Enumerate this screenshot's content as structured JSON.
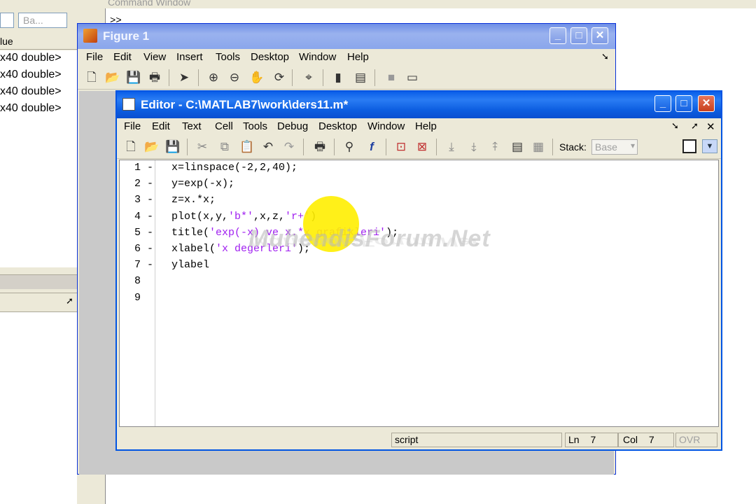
{
  "workspace": {
    "select_a": "",
    "select_b": "Ba...",
    "header": "lue",
    "rows": [
      "x40 double>",
      "x40 double>",
      "x40 double>",
      "x40 double>"
    ],
    "chevrons": "»"
  },
  "command_window": {
    "title": "Command Window",
    "prompt": ">>"
  },
  "figure": {
    "title": "Figure 1",
    "menu": [
      "File",
      "Edit",
      "View",
      "Insert",
      "Tools",
      "Desktop",
      "Window",
      "Help"
    ]
  },
  "editor": {
    "title": "Editor - C:\\MATLAB7\\work\\ders11.m*",
    "menu": [
      "File",
      "Edit",
      "Text",
      "Cell",
      "Tools",
      "Debug",
      "Desktop",
      "Window",
      "Help"
    ],
    "stack_label": "Stack:",
    "stack_value": "Base",
    "lines": [
      {
        "num": "1",
        "dash": "-",
        "parts": [
          {
            "t": "x=linspace(-2,2,40);",
            "s": false
          }
        ]
      },
      {
        "num": "2",
        "dash": "-",
        "parts": [
          {
            "t": "y=exp(-x);",
            "s": false
          }
        ]
      },
      {
        "num": "3",
        "dash": "-",
        "parts": [
          {
            "t": "z=x.*x;",
            "s": false
          }
        ]
      },
      {
        "num": "4",
        "dash": "-",
        "parts": [
          {
            "t": "plot(x,y,",
            "s": false
          },
          {
            "t": "'b*'",
            "s": true
          },
          {
            "t": ",x,z,",
            "s": false
          },
          {
            "t": "'r+'",
            "s": true
          },
          {
            "t": ")",
            "s": false
          }
        ]
      },
      {
        "num": "5",
        "dash": "-",
        "parts": [
          {
            "t": "title(",
            "s": false
          },
          {
            "t": "'exp(-x) ve x.*x grafikleri'",
            "s": true
          },
          {
            "t": ");",
            "s": false
          }
        ]
      },
      {
        "num": "6",
        "dash": "-",
        "parts": [
          {
            "t": "xlabel(",
            "s": false
          },
          {
            "t": "'x degerleri'",
            "s": true
          },
          {
            "t": ");",
            "s": false
          }
        ]
      },
      {
        "num": "7",
        "dash": "-",
        "parts": [
          {
            "t": "ylabel",
            "s": false
          }
        ]
      },
      {
        "num": "8",
        "dash": "",
        "parts": []
      },
      {
        "num": "9",
        "dash": "",
        "parts": []
      }
    ],
    "status": {
      "mode": "script",
      "ln_label": "Ln",
      "ln": "7",
      "col_label": "Col",
      "col": "7",
      "ovr": "OVR"
    }
  },
  "watermark": "MuhendisForum.Net",
  "colors": {
    "string": "#a020f0",
    "editor_title": "#0a5fe8",
    "figure_title": "#8aa6ec",
    "highlight": "#ffee00"
  }
}
